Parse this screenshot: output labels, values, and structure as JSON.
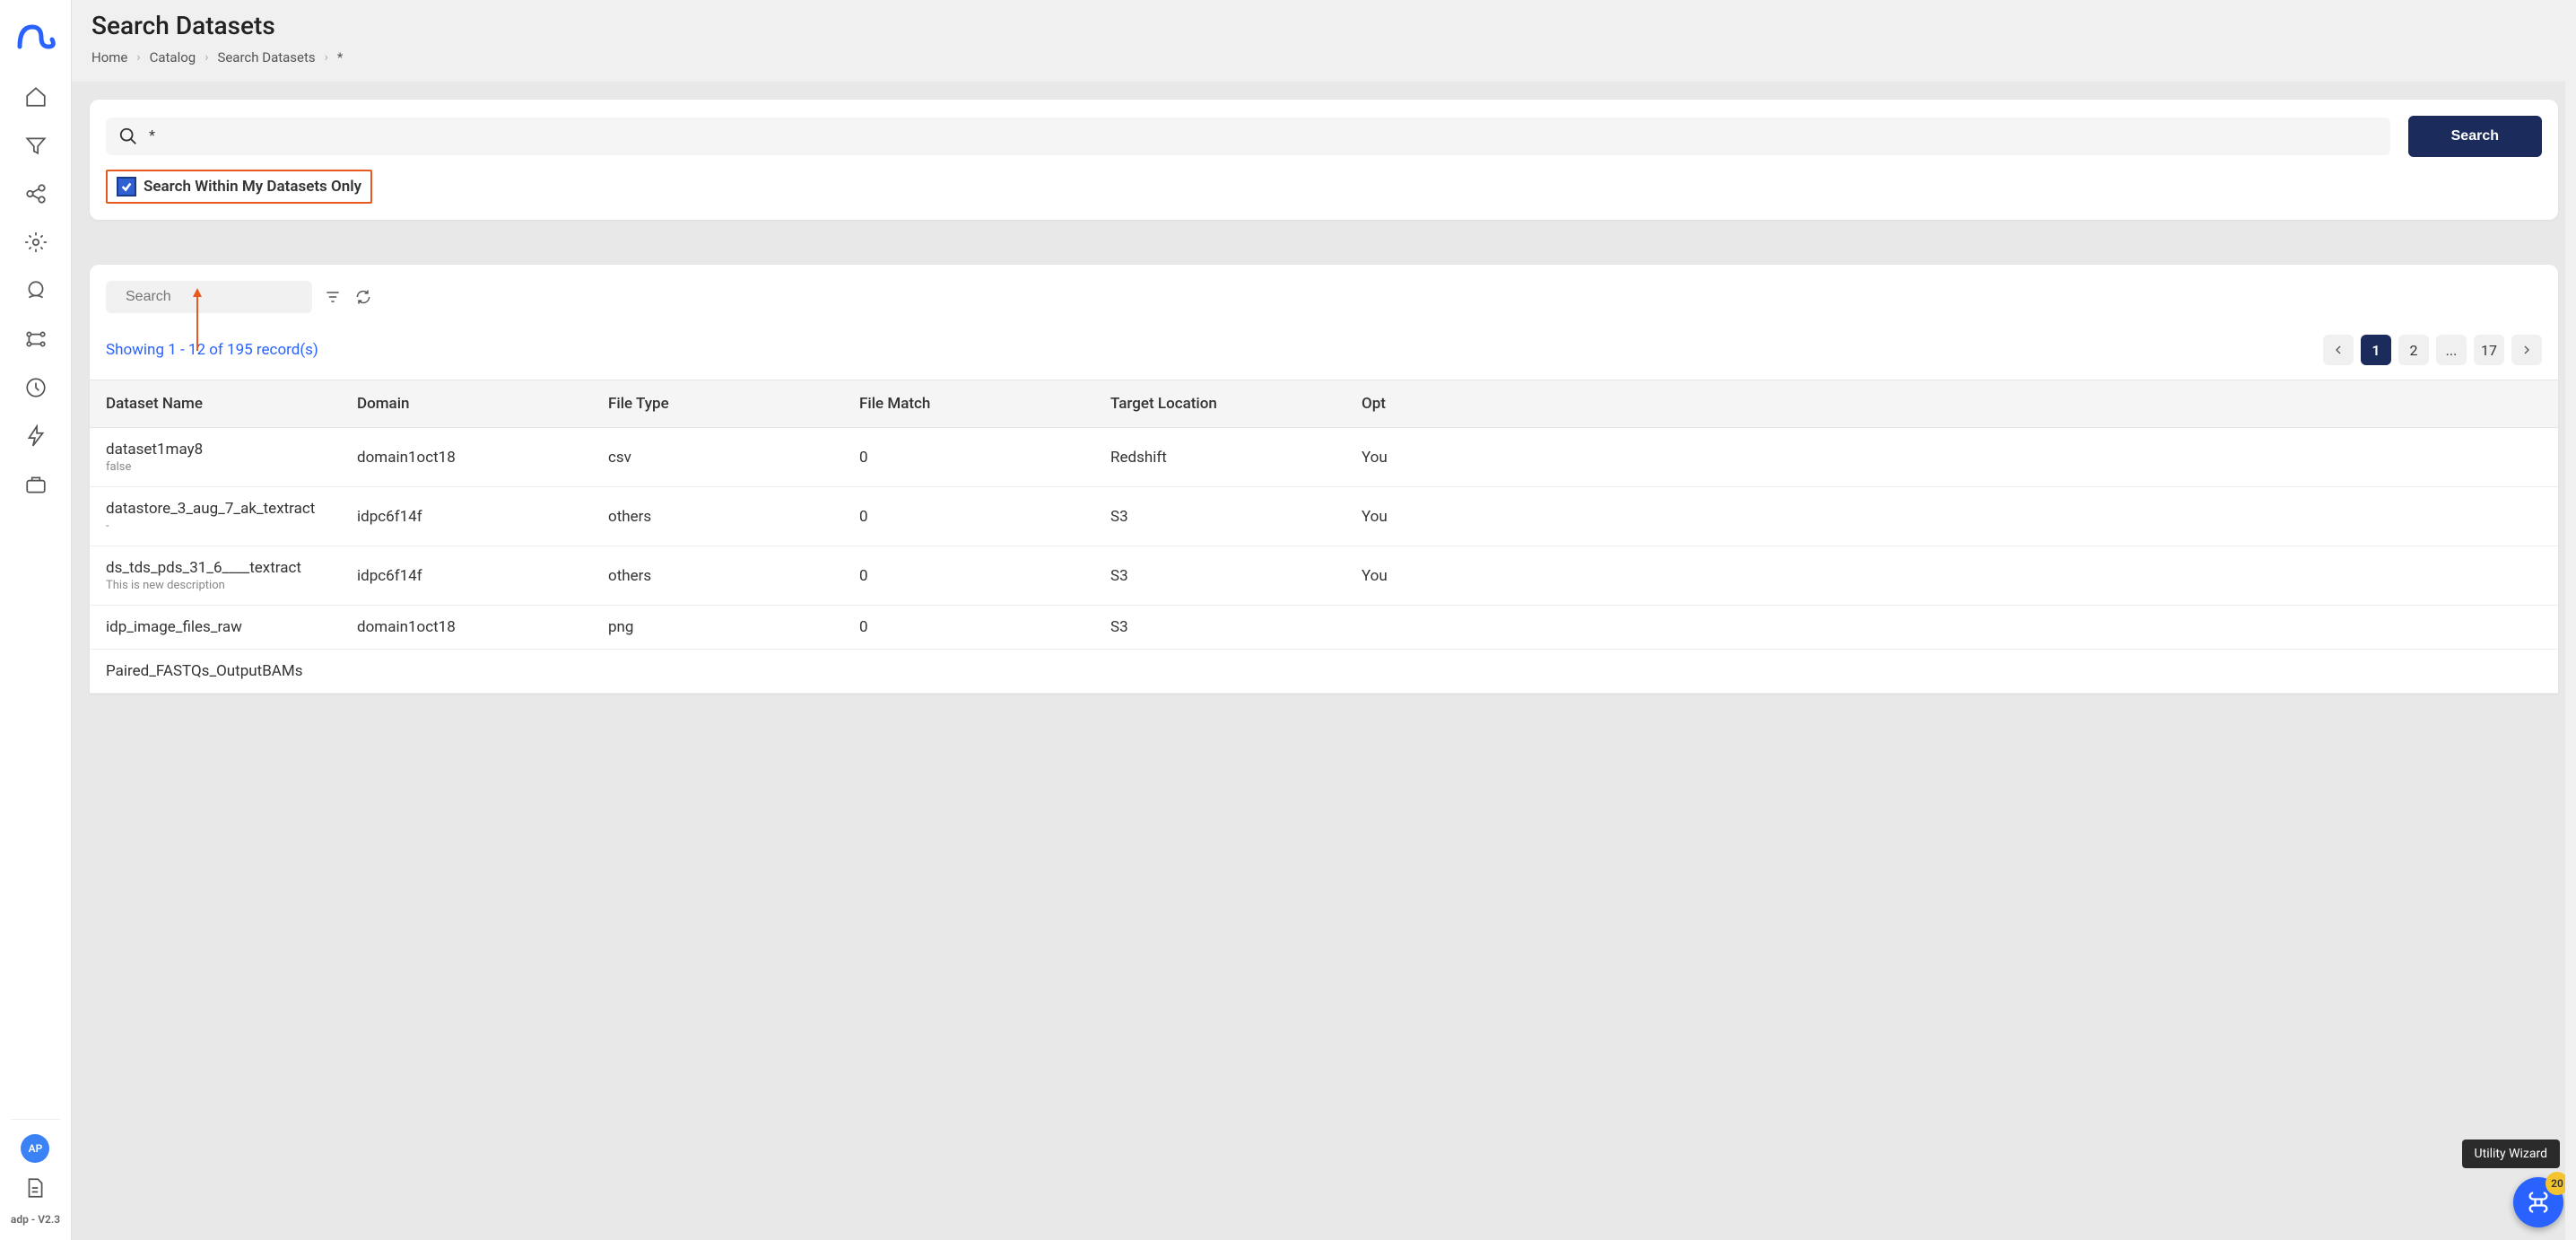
{
  "sidebar": {
    "avatar_initials": "AP",
    "version": "adp - V2.3"
  },
  "header": {
    "title": "Search Datasets",
    "breadcrumb": [
      "Home",
      "Catalog",
      "Search Datasets",
      "*"
    ]
  },
  "search": {
    "value": "*",
    "button": "Search",
    "checkbox_label": "Search Within My Datasets Only",
    "checked": true
  },
  "results": {
    "mini_search_placeholder": "Search",
    "records_text": "Showing 1 - 12 of 195 record(s)",
    "pagination": {
      "current": "1",
      "pages": [
        "1",
        "2",
        "...",
        "17"
      ]
    },
    "columns": [
      "Dataset Name",
      "Domain",
      "File Type",
      "File Match",
      "Target Location",
      "Opt"
    ],
    "rows": [
      {
        "name": "dataset1may8",
        "sub": "false",
        "domain": "domain1oct18",
        "file_type": "csv",
        "file_match": "0",
        "target": "Redshift",
        "opt": "You"
      },
      {
        "name": "datastore_3_aug_7_ak_textract",
        "sub": "-",
        "domain": "idpc6f14f",
        "file_type": "others",
        "file_match": "0",
        "target": "S3",
        "opt": "You"
      },
      {
        "name": "ds_tds_pds_31_6____textract",
        "sub": "This is new description",
        "domain": "idpc6f14f",
        "file_type": "others",
        "file_match": "0",
        "target": "S3",
        "opt": "You"
      },
      {
        "name": "idp_image_files_raw",
        "sub": "",
        "domain": "domain1oct18",
        "file_type": "png",
        "file_match": "0",
        "target": "S3",
        "opt": ""
      },
      {
        "name": "Paired_FASTQs_OutputBAMs",
        "sub": "",
        "domain": "",
        "file_type": "",
        "file_match": "",
        "target": "",
        "opt": ""
      }
    ]
  },
  "floating": {
    "tooltip": "Utility Wizard",
    "badge": "20"
  }
}
